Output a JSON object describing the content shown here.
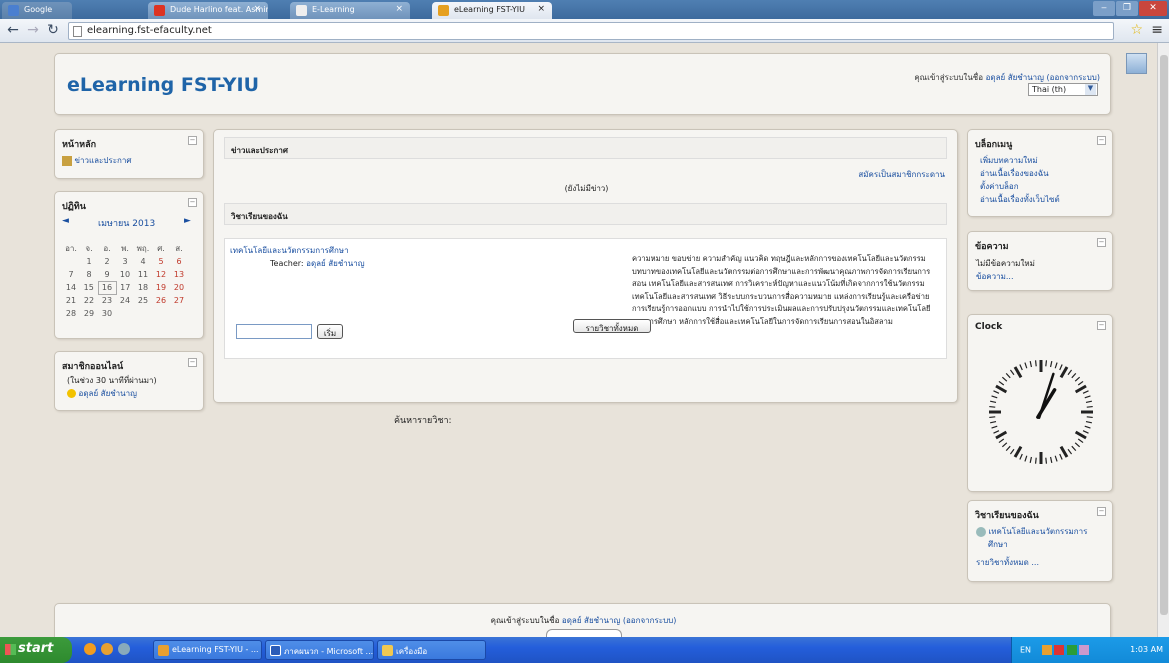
{
  "browser": {
    "tabs": [
      {
        "label": "Google"
      },
      {
        "label": "Dude Harlino feat. Asmirand"
      },
      {
        "label": "E-Learning"
      },
      {
        "label": "eLearning FST-YIU"
      }
    ],
    "address": "elearning.fst-efaculty.net"
  },
  "header": {
    "site_name": "eLearning FST-YIU",
    "login_prefix": "คุณเข้าสู่ระบบในชื่อ",
    "user_name": "อดุลย์ สัยชำนาญ",
    "logout": "(ออกจากระบบ)",
    "language": "Thai (th)"
  },
  "main_menu": {
    "title": "หน้าหลัก",
    "item": "ข่าวและประกาศ"
  },
  "calendar": {
    "title": "ปฏิทิน",
    "month": "เมษายน 2013",
    "weekdays": [
      "อา.",
      "จ.",
      "อ.",
      "พ.",
      "พฤ.",
      "ศ.",
      "ส."
    ],
    "weeks": [
      [
        "",
        "1",
        "2",
        "3",
        "4",
        "5",
        "6"
      ],
      [
        "7",
        "8",
        "9",
        "10",
        "11",
        "12",
        "13"
      ],
      [
        "14",
        "15",
        "16",
        "17",
        "18",
        "19",
        "20"
      ],
      [
        "21",
        "22",
        "23",
        "24",
        "25",
        "26",
        "27"
      ],
      [
        "28",
        "29",
        "30",
        "",
        "",
        "",
        ""
      ]
    ],
    "today": "16"
  },
  "online_users": {
    "title": "สมาชิกออนไลน์",
    "period": "(ในช่วง 30 นาทีที่ผ่านมา)",
    "user": "อดุลย์ สัยชำนาญ"
  },
  "news": {
    "title": "ข่าวและประกาศ",
    "subscribe": "สมัครเป็นสมาชิกกระดาน",
    "empty": "(ยังไม่มีข่าว)"
  },
  "my_courses": {
    "title": "วิชาเรียนของฉัน",
    "course_name": "เทคโนโลยีและนวัตกรรมการศึกษา",
    "teacher_label": "Teacher:",
    "teacher_name": "อดุลย์ สัยชำนาญ",
    "summary_lines": [
      "ความหมาย ขอบข่าย ความสำคัญ แนวคิด ทฤษฎีและหลักการของเทคโนโลยีและนวัตกรรม",
      "บทบาทของเทคโนโลยีและนวัตกรรมต่อการศึกษาและการพัฒนาคุณภาพการจัดการเรียนการ",
      "สอน เทคโนโลยีและสารสนเทศ การวิเคราะห์ปัญหาและแนวโน้มที่เกิดจากการใช้นวัตกรรม",
      "เทคโนโลยีและสารสนเทศ วิธีระบบกระบวนการสื่อความหมาย แหล่งการเรียนรู้และเครือข่าย",
      "การเรียนรู้การออกแบบ การนำไปใช้การประเมินผลและการปรับปรุงนวัตกรรมและเทคโนโลยี",
      "ทางการศึกษา หลักการใช้สื่อและเทคโนโลยีในการจัดการเรียนการสอนในอิสลาม"
    ],
    "search_label": "ค้นหารายวิชา:",
    "search_button": "เริ่ม",
    "all_courses_button": "รายวิชาทั้งหมด"
  },
  "blog_menu": {
    "title": "บล็อกเมนู",
    "items": [
      "เพิ่มบทความใหม่",
      "อ่านเนื้อเรื่องของฉัน",
      "ตั้งค่าบล็อก",
      "อ่านเนื้อเรื่องทั้งเว็บไซต์"
    ]
  },
  "messages": {
    "title": "ข้อความ",
    "none": "ไม่มีข้อความใหม่",
    "link": "ข้อความ..."
  },
  "clock": {
    "title": "Clock",
    "hour": 1,
    "minute": 3
  },
  "my_courses_block": {
    "title": "วิชาเรียนของฉัน",
    "course_line1": "เทคโนโลยีและนวัตกรรมการ",
    "course_line2": "ศึกษา",
    "all": "รายวิชาทั้งหมด ..."
  },
  "footer": {
    "login_prefix": "คุณเข้าสู่ระบบในชื่อ",
    "user_name": "อดุลย์ สัยชำนาญ",
    "logout": "(ออกจากระบบ)"
  },
  "taskbar": {
    "start": "start",
    "items": [
      "eLearning FST-YIU - ...",
      "ภาคผนวก - Microsoft ...",
      "เครื่องมือ"
    ],
    "lang": "EN",
    "time": "1:03 AM"
  }
}
